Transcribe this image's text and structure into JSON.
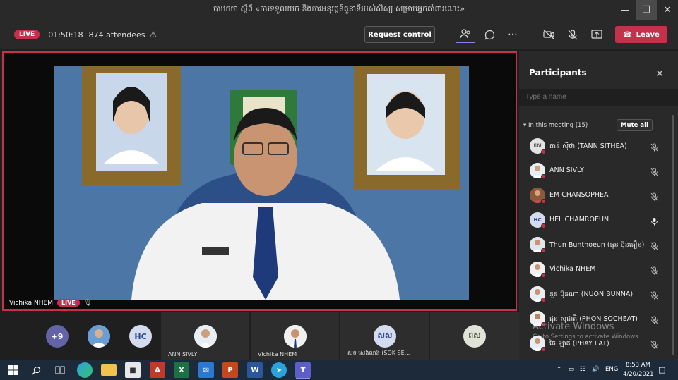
{
  "window": {
    "title": "បាឋកថា ស្តីពី «ការទទួលយក និងការអនុវត្តន៍តួនាទីរបស់សិស្ស សម្រាប់អ្នកគាំពារណេះ»"
  },
  "toolbar": {
    "live_badge": "LIVE",
    "duration": "01:50:18",
    "attendees": "874 attendees",
    "request_control": "Request control",
    "leave": "Leave"
  },
  "stage": {
    "speaker_name": "Vichika NHEM",
    "live_badge": "LIVE"
  },
  "strip": {
    "overflow_count": "+9",
    "tiles": [
      {
        "initials": "HC"
      },
      {
        "name": "ANN SIVLY"
      },
      {
        "name": "Vichika NHEM"
      },
      {
        "initials": "សស",
        "name": "សុខ សេងលាង (SOK SE..."
      },
      {
        "initials": "ពស"
      }
    ]
  },
  "participants": {
    "title": "Participants",
    "search_placeholder": "Type a name",
    "section": "In this meeting (15)",
    "mute_all": "Mute all",
    "people": [
      {
        "initials": "តស",
        "name": "តាន់ ស៊ីថា (TANN SITHEA)",
        "mic": "muted"
      },
      {
        "initials": "",
        "name": "ANN SIVLY",
        "mic": "muted"
      },
      {
        "initials": "",
        "name": "EM CHANSOPHEA",
        "mic": "muted"
      },
      {
        "initials": "HC",
        "name": "HEL CHAMROEUN",
        "mic": "on"
      },
      {
        "initials": "",
        "name": "Thun Bunthoeun (ធុន ប៊ុនធឿន)",
        "mic": "muted"
      },
      {
        "initials": "",
        "name": "Vichika NHEM",
        "mic": "muted"
      },
      {
        "initials": "",
        "name": "នួន ប៊ុនណា (NUON BUNNA)",
        "mic": "muted"
      },
      {
        "initials": "",
        "name": "ផុន សុជាតិ (PHON SOCHEAT)",
        "mic": "muted"
      },
      {
        "initials": "",
        "name": "ផៃ ឡាត (PHAY LAT)",
        "mic": "muted"
      }
    ]
  },
  "watermark": {
    "line1": "Activate Windows",
    "line2": "Go to Settings to activate Windows."
  },
  "taskbar": {
    "language": "ENG",
    "time": "8:53 AM",
    "date": "4/20/2021"
  },
  "colors": {
    "accent_red": "#c4314b",
    "panel_bg": "#292929",
    "stage_bg": "#1f1f1f"
  }
}
